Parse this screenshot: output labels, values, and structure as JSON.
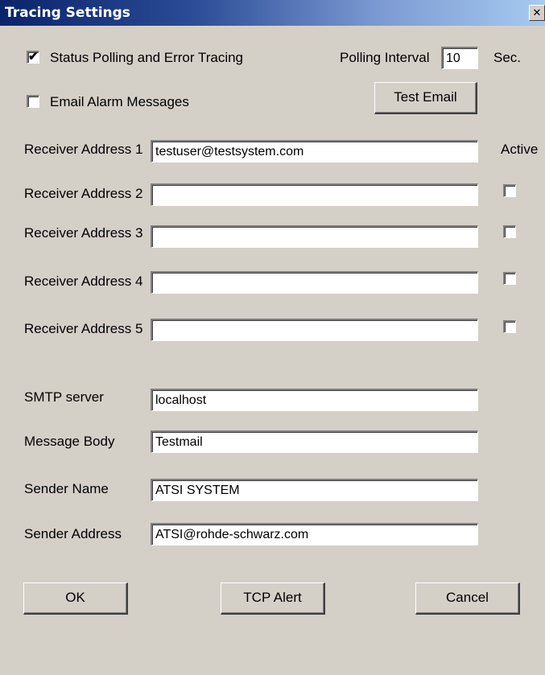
{
  "window": {
    "title": "Tracing Settings",
    "close_glyph": "✕"
  },
  "status_polling": {
    "label": "Status Polling and Error Tracing",
    "checked": true,
    "check_glyph": "✔"
  },
  "polling_interval": {
    "label": "Polling Interval",
    "value": "10",
    "unit": "Sec."
  },
  "email_alarm": {
    "label": "Email Alarm Messages",
    "checked": false
  },
  "test_email_label": "Test Email",
  "active_label": "Active",
  "receivers": [
    {
      "label": "Receiver Address 1",
      "value": "testuser@testsystem.com"
    },
    {
      "label": "Receiver Address 2",
      "value": ""
    },
    {
      "label": "Receiver Address 3",
      "value": ""
    },
    {
      "label": "Receiver Address 4",
      "value": ""
    },
    {
      "label": "Receiver Address 5",
      "value": ""
    }
  ],
  "smtp": {
    "label": "SMTP server",
    "value": "localhost"
  },
  "message_body": {
    "label": "Message Body",
    "value": "Testmail"
  },
  "sender_name": {
    "label": "Sender Name",
    "value": "ATSI SYSTEM"
  },
  "sender_address": {
    "label": "Sender Address",
    "value": "ATSI@rohde-schwarz.com"
  },
  "buttons": {
    "ok": "OK",
    "tcp_alert": "TCP Alert",
    "cancel": "Cancel"
  },
  "colors": {
    "face": "#d4d0c8",
    "title_start": "#0a246a",
    "title_end": "#a6caf0"
  }
}
